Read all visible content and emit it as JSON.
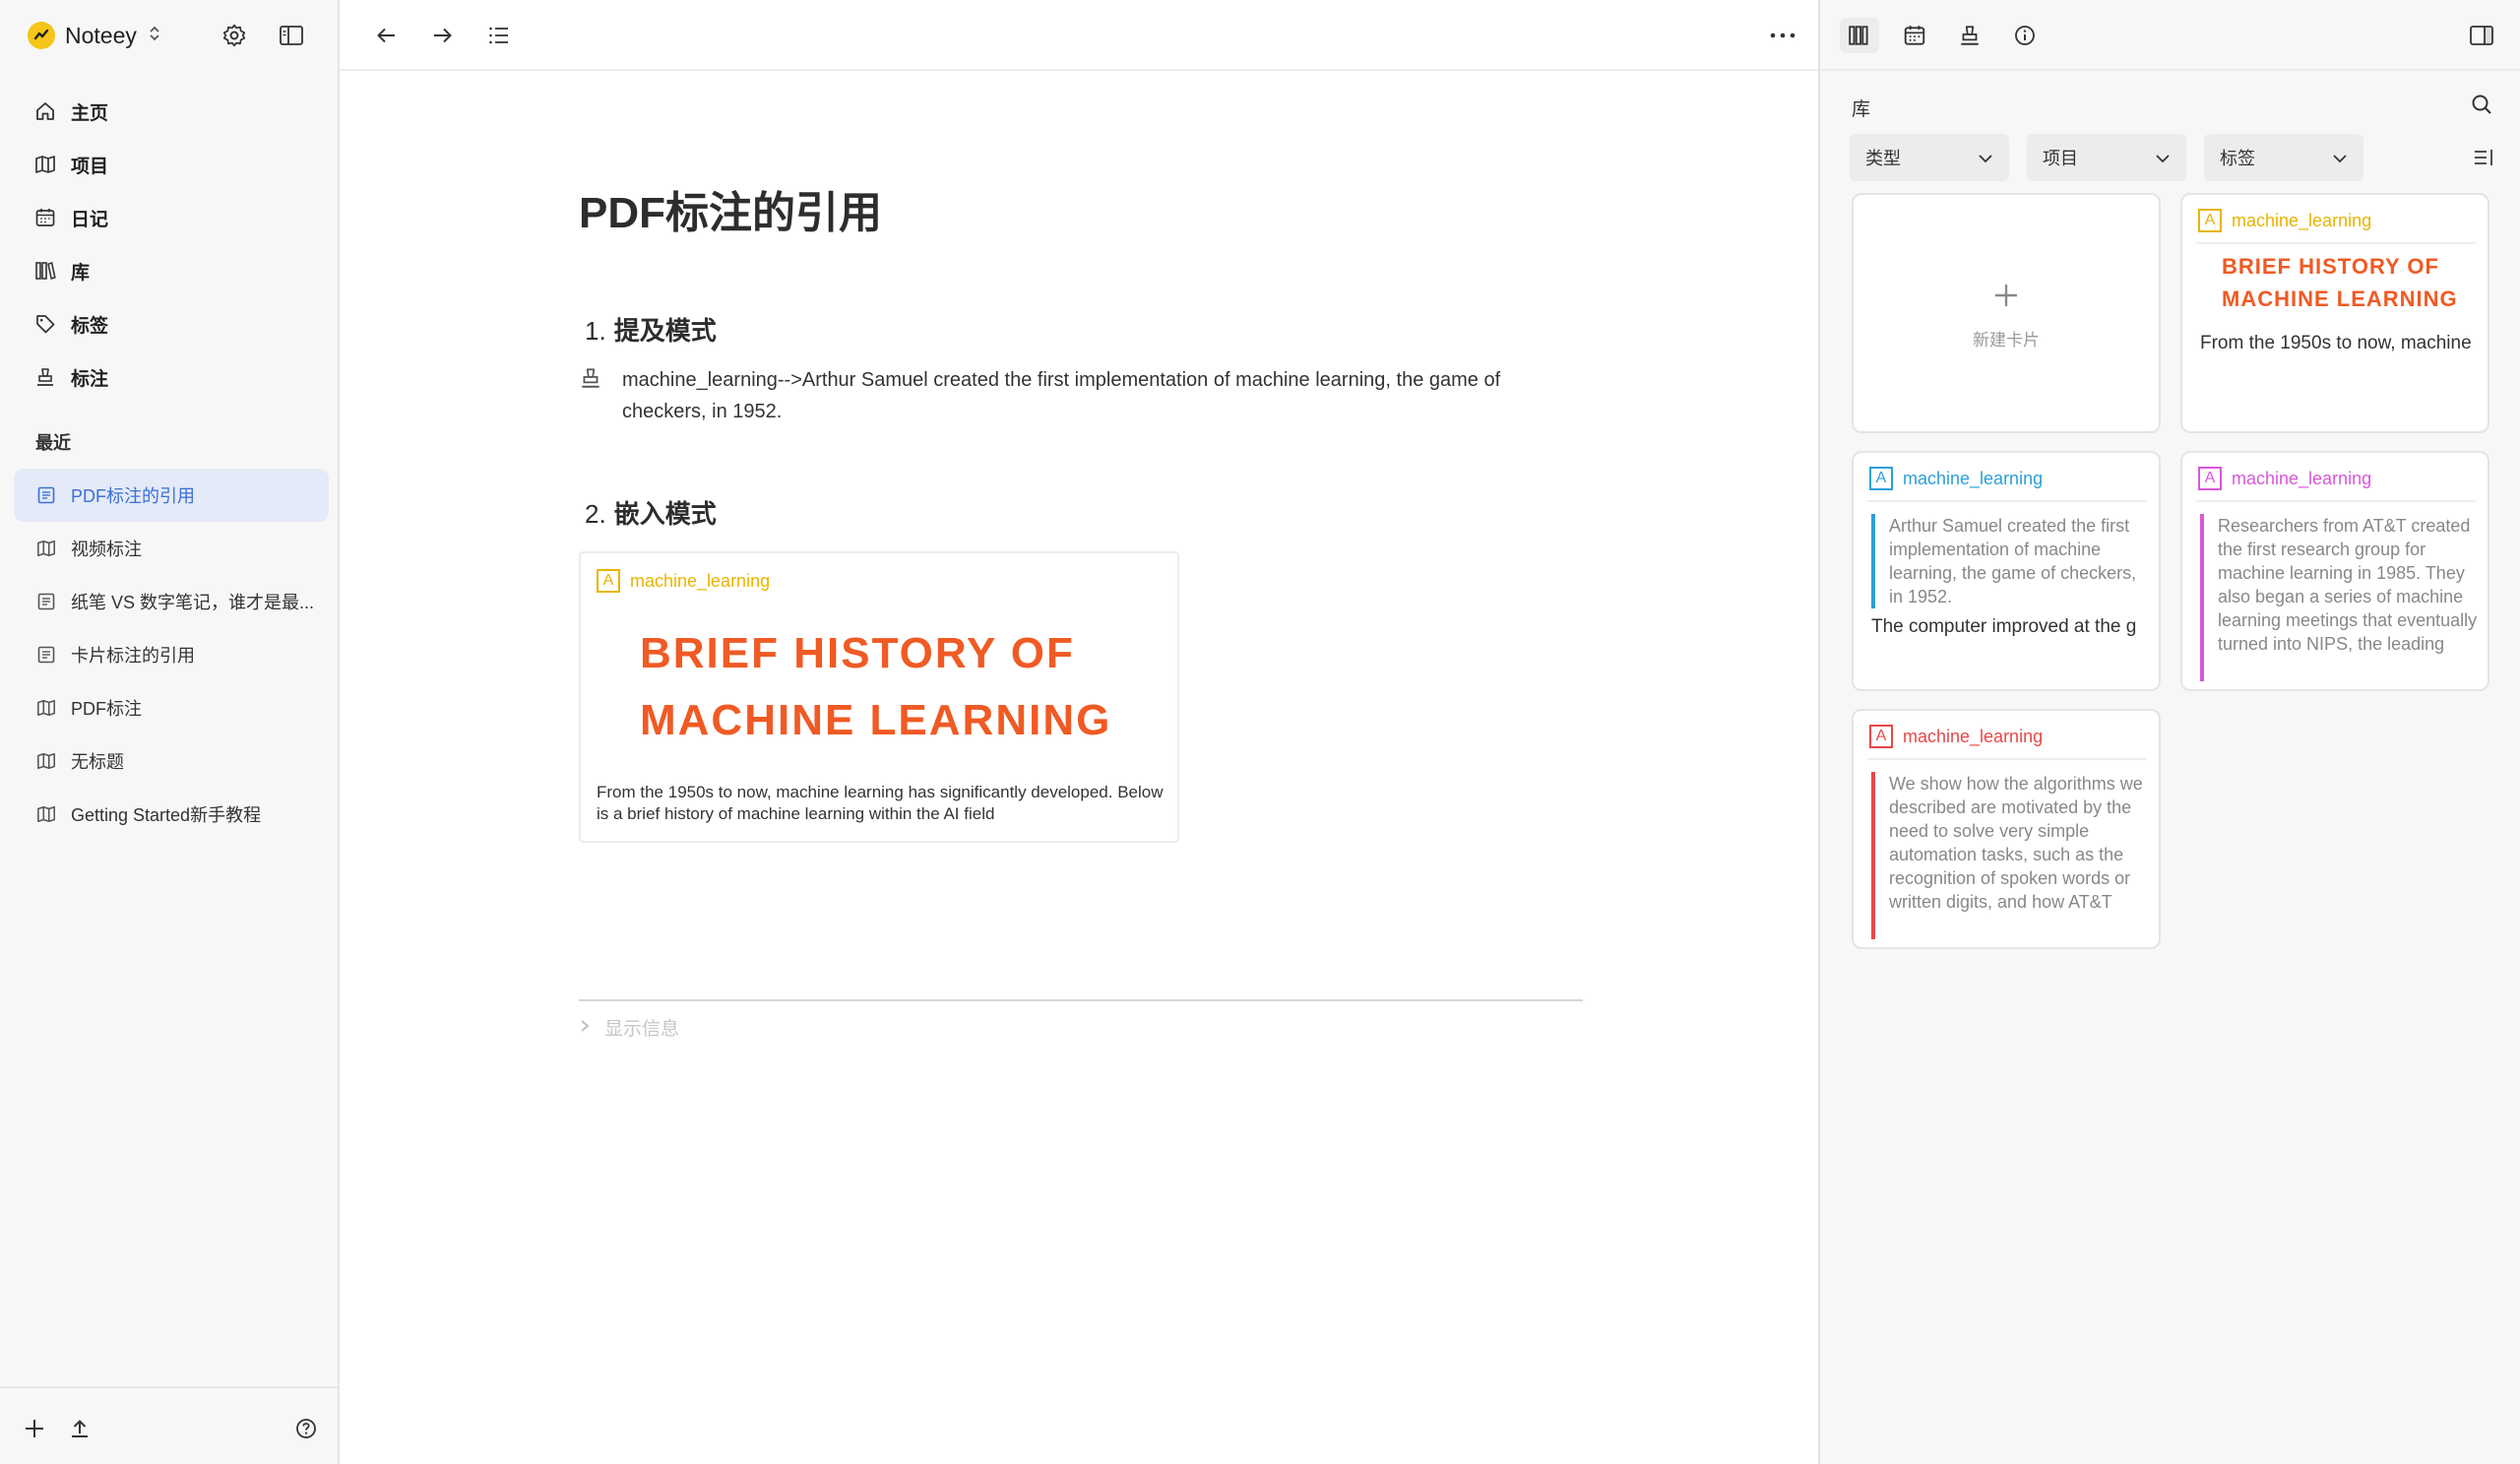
{
  "app": {
    "name": "Noteey",
    "brand_color": "#f5c518"
  },
  "sidebar": {
    "nav": [
      {
        "label": "主页",
        "icon": "home-icon"
      },
      {
        "label": "项目",
        "icon": "map-icon"
      },
      {
        "label": "日记",
        "icon": "calendar-icon"
      },
      {
        "label": "库",
        "icon": "library-icon"
      },
      {
        "label": "标签",
        "icon": "tag-icon"
      },
      {
        "label": "标注",
        "icon": "annotation-icon"
      }
    ],
    "recent_title": "最近",
    "recent": [
      {
        "label": "PDF标注的引用",
        "icon": "document-icon",
        "active": true
      },
      {
        "label": "视频标注",
        "icon": "map-icon"
      },
      {
        "label": "纸笔 VS 数字笔记，谁才是最...",
        "icon": "document-icon"
      },
      {
        "label": "卡片标注的引用",
        "icon": "document-icon"
      },
      {
        "label": "PDF标注",
        "icon": "map-icon"
      },
      {
        "label": "无标题",
        "icon": "map-icon"
      },
      {
        "label": "Getting Started新手教程",
        "icon": "map-icon"
      }
    ],
    "active_color": "#3b6fd8"
  },
  "document": {
    "title": "PDF标注的引用",
    "sections": [
      {
        "number": "1.",
        "heading": "提及模式"
      },
      {
        "number": "2.",
        "heading": "嵌入模式"
      }
    ],
    "mention_text": "machine_learning-->Arthur Samuel created the first implementation of machine  learning, the game of checkers, in 1952.",
    "embed": {
      "tag": "machine_learning",
      "tag_letter": "A",
      "image_title": "BRIEF HISTORY OF MACHINE LEARNING",
      "description": "From the 1950s to now, machine learning has significantly  developed. Below is a brief history of machine learning within the  AI field"
    },
    "show_info": "显示信息"
  },
  "right_panel": {
    "label": "库",
    "filters": [
      "类型",
      "项目",
      "标签"
    ],
    "new_card_label": "新建卡片",
    "cards": [
      {
        "tag": "machine_learning",
        "tag_letter": "A",
        "color": "#e8b400",
        "image_title": "BRIEF HISTORY OF MACHINE LEARNING",
        "footer": "From the 1950s to now, machine"
      },
      {
        "tag": "machine_learning",
        "tag_letter": "A",
        "color": "#2d9fd8",
        "quote": "Arthur Samuel created the first implementation of machine learning, the game of checkers, in 1952.",
        "footer": "The computer improved  at the g"
      },
      {
        "tag": "machine_learning",
        "tag_letter": "A",
        "color": "#d957d9",
        "quote": "Researchers from AT&T created the first research group for machine learning in 1985. They also began a series of machine learning meetings that eventually turned into NIPS, the leading"
      },
      {
        "tag": "machine_learning",
        "tag_letter": "A",
        "color": "#e84848",
        "quote": "We show how the algorithms we described are motivated by the need to solve very simple automation tasks, such as the recognition of spoken words or written digits, and how AT&T"
      }
    ]
  },
  "colors": {
    "highlight_orange": "#f05a24"
  }
}
